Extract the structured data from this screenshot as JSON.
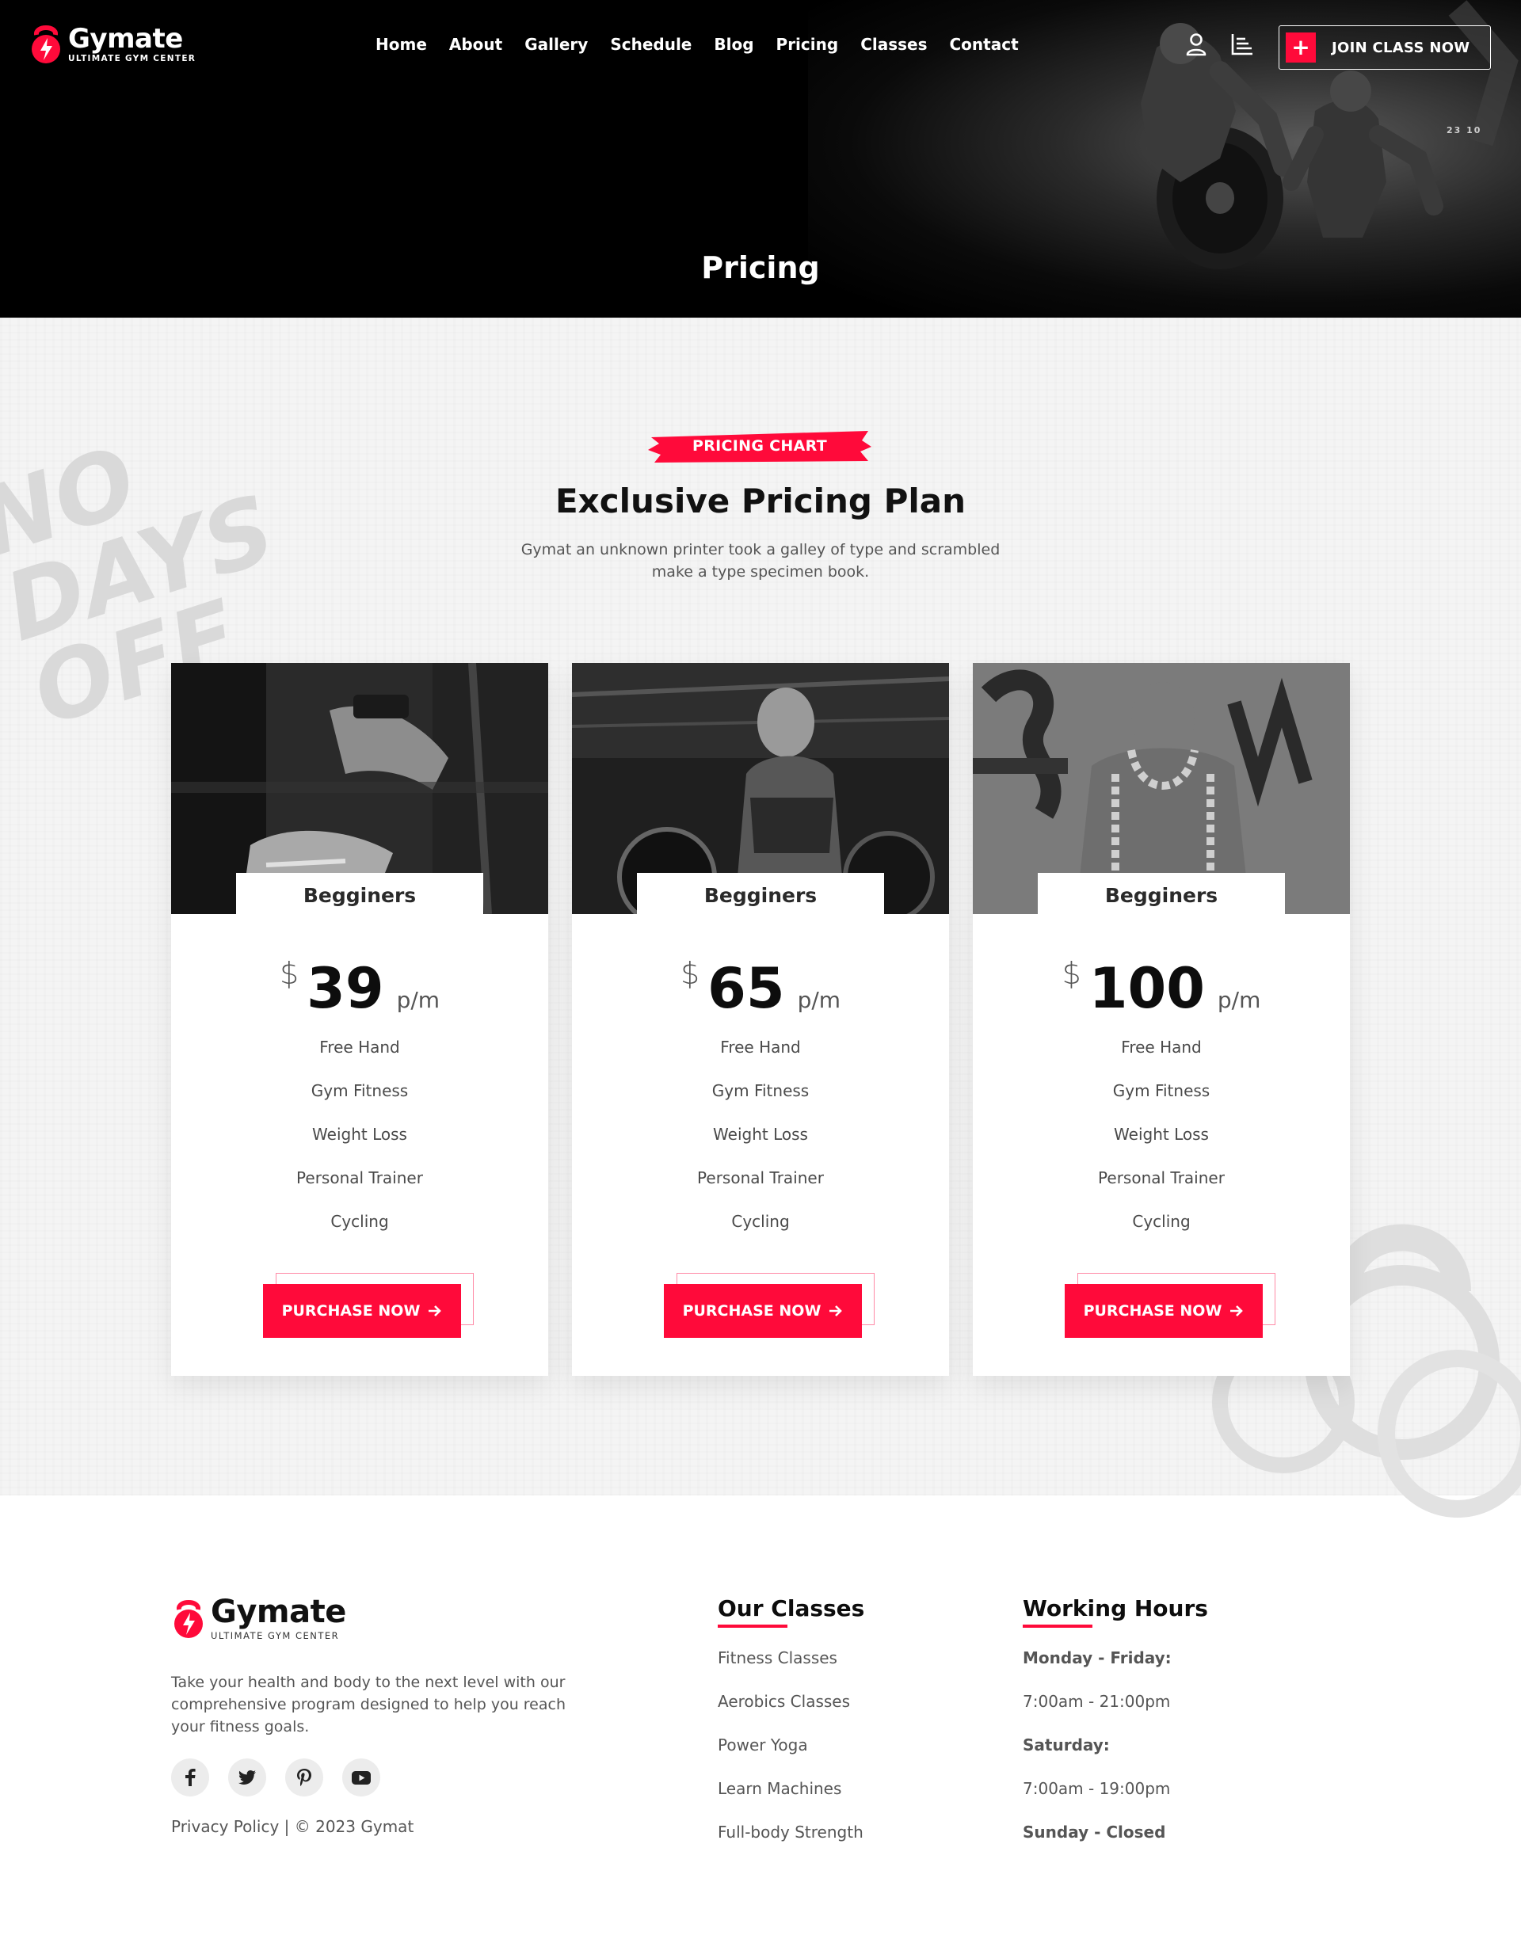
{
  "brand": {
    "name": "Gymate",
    "tagline": "ULTIMATE GYM CENTER"
  },
  "nav": {
    "items": [
      "Home",
      "About",
      "Gallery",
      "Schedule",
      "Blog",
      "Pricing",
      "Classes",
      "Contact"
    ]
  },
  "header": {
    "join_label": "JOIN CLASS NOW",
    "hero_title": "Pricing",
    "hero_badge": "23 10"
  },
  "section": {
    "chip": "PRICING CHART",
    "title": "Exclusive Pricing Plan",
    "subtitle": "Gymat an unknown printer took a galley of type and scrambled make a type specimen book.",
    "watermark": "NO DAYS OFF"
  },
  "plans": [
    {
      "name": "Begginers",
      "currency": "$",
      "price": "39",
      "period": "p/m",
      "features": [
        "Free Hand",
        "Gym Fitness",
        "Weight Loss",
        "Personal Trainer",
        "Cycling"
      ],
      "button": "PURCHASE NOW"
    },
    {
      "name": "Begginers",
      "currency": "$",
      "price": "65",
      "period": "p/m",
      "features": [
        "Free Hand",
        "Gym Fitness",
        "Weight Loss",
        "Personal Trainer",
        "Cycling"
      ],
      "button": "PURCHASE NOW"
    },
    {
      "name": "Begginers",
      "currency": "$",
      "price": "100",
      "period": "p/m",
      "features": [
        "Free Hand",
        "Gym Fitness",
        "Weight Loss",
        "Personal Trainer",
        "Cycling"
      ],
      "button": "PURCHASE NOW"
    }
  ],
  "footer": {
    "about": "Take your health and body to the next level with our comprehensive program designed to help you reach your fitness goals.",
    "social": [
      "facebook-icon",
      "twitter-icon",
      "pinterest-icon",
      "youtube-icon"
    ],
    "copyright": "Privacy Policy | © 2023 Gymat",
    "classes_title": "Our Classes",
    "classes": [
      "Fitness Classes",
      "Aerobics Classes",
      "Power Yoga",
      "Learn Machines",
      "Full-body Strength"
    ],
    "hours_title": "Working Hours",
    "hours": [
      "Monday - Friday:",
      "7:00am - 21:00pm",
      "Saturday:",
      "7:00am - 19:00pm",
      "Sunday - Closed"
    ]
  },
  "colors": {
    "accent": "#ff0a3a",
    "hero_bg": "#000000",
    "section_bg": "#f4f4f4"
  }
}
